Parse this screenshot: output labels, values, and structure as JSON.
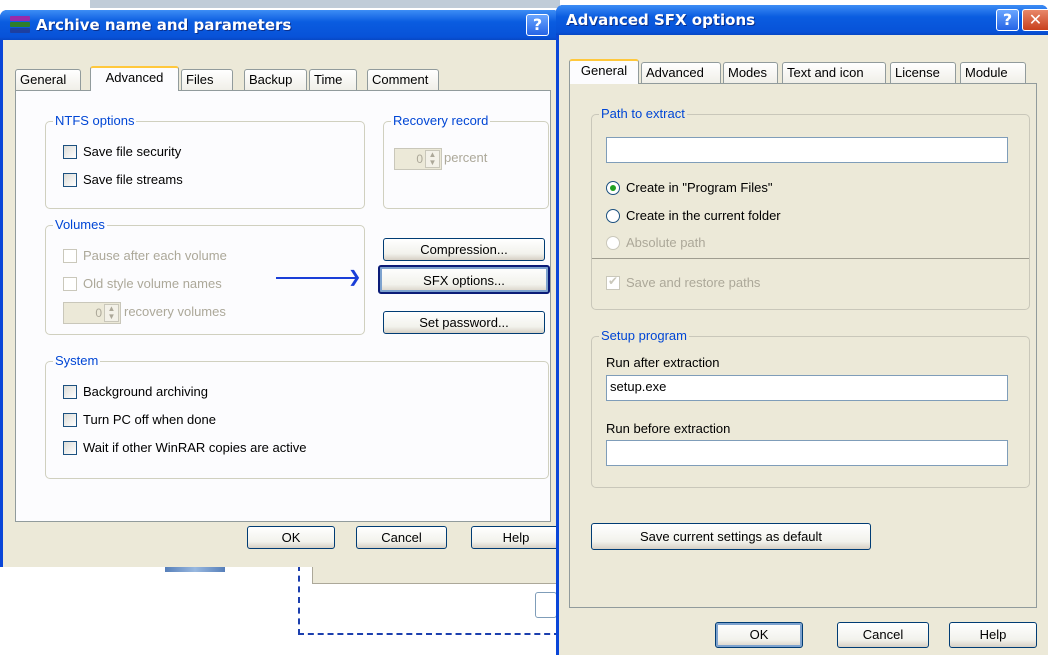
{
  "archive_dialog": {
    "title": "Archive name and parameters",
    "help_symbol": "?",
    "tabs": [
      {
        "label": "General"
      },
      {
        "label": "Advanced"
      },
      {
        "label": "Files"
      },
      {
        "label": "Backup"
      },
      {
        "label": "Time"
      },
      {
        "label": "Comment"
      }
    ],
    "selected_tab": "Advanced",
    "ntfs": {
      "title": "NTFS options",
      "save_security": "Save file security",
      "save_streams": "Save file streams"
    },
    "recovery": {
      "title": "Recovery record",
      "value": "0",
      "unit": "percent"
    },
    "volumes": {
      "title": "Volumes",
      "pause": "Pause after each volume",
      "old_names": "Old style volume names",
      "rec_value": "0",
      "rec_label": "recovery volumes"
    },
    "buttons": {
      "compression": "Compression...",
      "sfx": "SFX options...",
      "password": "Set password...",
      "ok": "OK",
      "cancel": "Cancel",
      "help": "Help"
    },
    "system": {
      "title": "System",
      "background": "Background archiving",
      "turn_off": "Turn PC off when done",
      "wait": "Wait if other WinRAR copies are active"
    }
  },
  "sfx_dialog": {
    "title": "Advanced SFX options",
    "help_symbol": "?",
    "close_symbol": "✕",
    "tabs": [
      {
        "label": "General"
      },
      {
        "label": "Advanced"
      },
      {
        "label": "Modes"
      },
      {
        "label": "Text and icon"
      },
      {
        "label": "License"
      },
      {
        "label": "Module"
      }
    ],
    "selected_tab": "General",
    "path": {
      "title": "Path to extract",
      "value": "",
      "opt_program_files": "Create in \"Program Files\"",
      "opt_current": "Create in the current folder",
      "opt_absolute": "Absolute path",
      "save_restore": "Save and restore paths"
    },
    "setup": {
      "title": "Setup program",
      "run_after_label": "Run after extraction",
      "run_after_value": "setup.exe",
      "run_before_label": "Run before extraction",
      "run_before_value": ""
    },
    "save_default": "Save current settings as default",
    "buttons": {
      "ok": "OK",
      "cancel": "Cancel",
      "help": "Help"
    }
  },
  "colors": {
    "title_blue": "#0a5ce0",
    "dialog_face": "#ece9d8",
    "group_label": "#0046d5",
    "arrow": "#1a3fd8"
  }
}
